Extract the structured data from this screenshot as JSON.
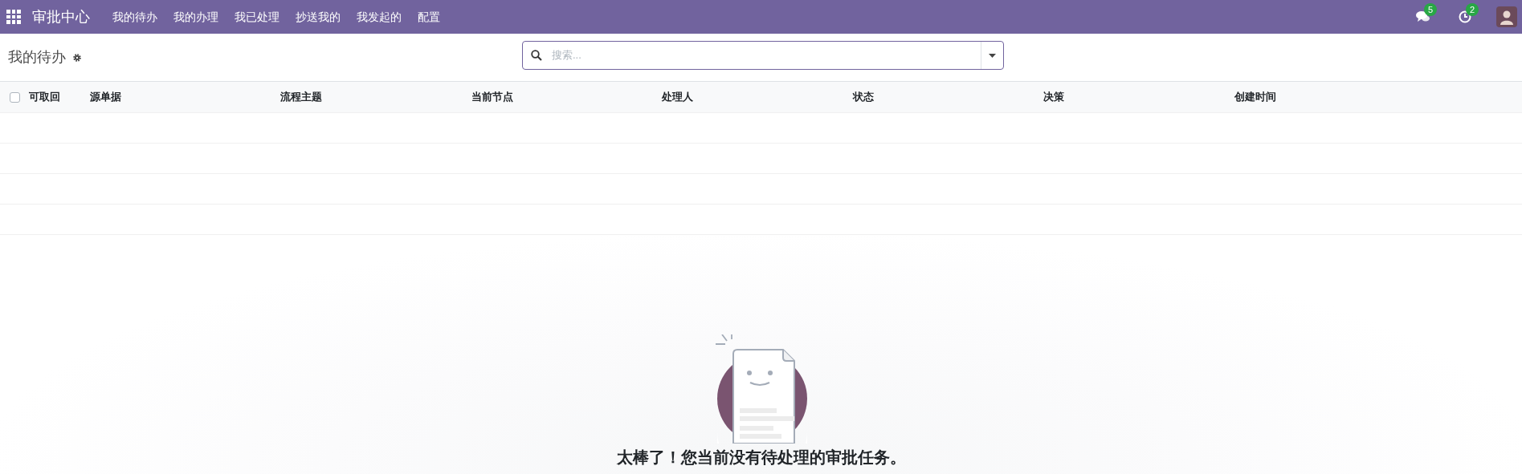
{
  "navbar": {
    "app_title": "审批中心",
    "menu": [
      {
        "label": "我的待办"
      },
      {
        "label": "我的办理"
      },
      {
        "label": "我已处理"
      },
      {
        "label": "抄送我的"
      },
      {
        "label": "我发起的"
      },
      {
        "label": "配置"
      }
    ],
    "messages_badge": "5",
    "activities_badge": "2"
  },
  "control_panel": {
    "title": "我的待办",
    "search": {
      "placeholder": "搜索..."
    }
  },
  "table": {
    "select_all_checked": false,
    "columns": [
      "可取回",
      "源单据",
      "流程主题",
      "当前节点",
      "处理人",
      "状态",
      "决策",
      "创建时间"
    ]
  },
  "empty_state": {
    "message": "太棒了！您当前没有待处理的审批任务。"
  }
}
